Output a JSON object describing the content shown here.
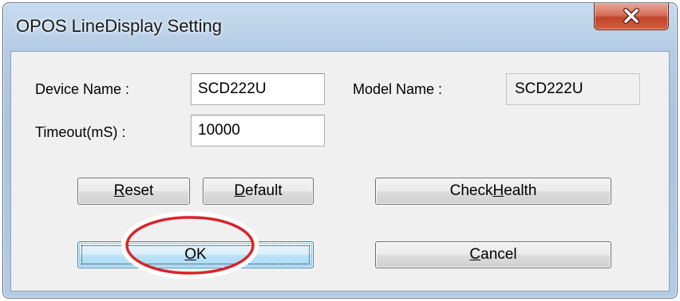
{
  "window": {
    "title": "OPOS LineDisplay Setting"
  },
  "title_bar": {
    "close_icon": "close-x-icon",
    "close_color": "#c8452b"
  },
  "form": {
    "device_name_label": "Device Name :",
    "device_name_value": "SCD222U",
    "model_name_label": "Model Name :",
    "model_name_value": "SCD222U",
    "timeout_label": "Timeout(mS) :",
    "timeout_value": "10000"
  },
  "buttons": {
    "reset": {
      "mnemonic": "R",
      "rest": "eset"
    },
    "default": {
      "mnemonic": "D",
      "rest": "efault"
    },
    "checkhealth": {
      "before": "Check",
      "mnemonic": "H",
      "after": "ealth"
    },
    "ok": {
      "mnemonic": "O",
      "rest": "K"
    },
    "cancel": {
      "mnemonic": "C",
      "rest": "ancel"
    }
  },
  "annotation": {
    "highlight_color": "#d7252c"
  }
}
